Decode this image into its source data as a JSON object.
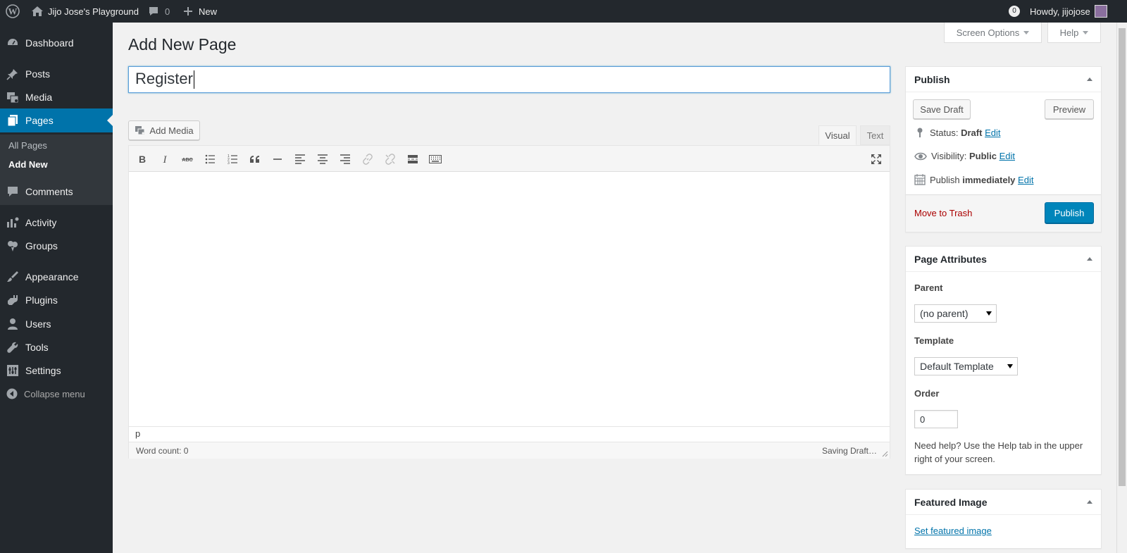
{
  "adminbar": {
    "site_name": "Jijo Jose's Playground",
    "comments_count": "0",
    "new_label": "New",
    "notifications_count": "0",
    "greeting": "Howdy, jijojose"
  },
  "sidebar": {
    "items": [
      {
        "label": "Dashboard",
        "icon": "dashboard-icon"
      },
      {
        "label": "Posts",
        "icon": "pin-icon"
      },
      {
        "label": "Media",
        "icon": "media-icon"
      },
      {
        "label": "Pages",
        "icon": "pages-icon"
      },
      {
        "label": "Comments",
        "icon": "comment-icon"
      },
      {
        "label": "Activity",
        "icon": "activity-icon"
      },
      {
        "label": "Groups",
        "icon": "groups-icon"
      },
      {
        "label": "Appearance",
        "icon": "brush-icon"
      },
      {
        "label": "Plugins",
        "icon": "plugin-icon"
      },
      {
        "label": "Users",
        "icon": "user-icon"
      },
      {
        "label": "Tools",
        "icon": "wrench-icon"
      },
      {
        "label": "Settings",
        "icon": "settings-icon"
      }
    ],
    "submenu": {
      "all_pages": "All Pages",
      "add_new": "Add New"
    },
    "collapse": "Collapse menu"
  },
  "screen_options": "Screen Options",
  "help": "Help",
  "page_title": "Add New Page",
  "title_value": "Register",
  "editor": {
    "add_media": "Add Media",
    "tab_visual": "Visual",
    "tab_text": "Text",
    "path": "p",
    "word_count": "Word count: 0",
    "saving": "Saving Draft…"
  },
  "publish": {
    "heading": "Publish",
    "save_draft": "Save Draft",
    "preview": "Preview",
    "status_label": "Status:",
    "status_value": "Draft",
    "visibility_label": "Visibility:",
    "visibility_value": "Public",
    "publish_label": "Publish",
    "publish_value": "immediately",
    "edit": "Edit",
    "move_to_trash": "Move to Trash",
    "publish_button": "Publish"
  },
  "page_attributes": {
    "heading": "Page Attributes",
    "parent_label": "Parent",
    "parent_value": "(no parent)",
    "template_label": "Template",
    "template_value": "Default Template",
    "order_label": "Order",
    "order_value": "0",
    "help_text": "Need help? Use the Help tab in the upper right of your screen."
  },
  "featured_image": {
    "heading": "Featured Image",
    "link": "Set featured image"
  },
  "colors": {
    "accent": "#0073aa",
    "adminbar": "#23282d",
    "trash": "#a00"
  }
}
